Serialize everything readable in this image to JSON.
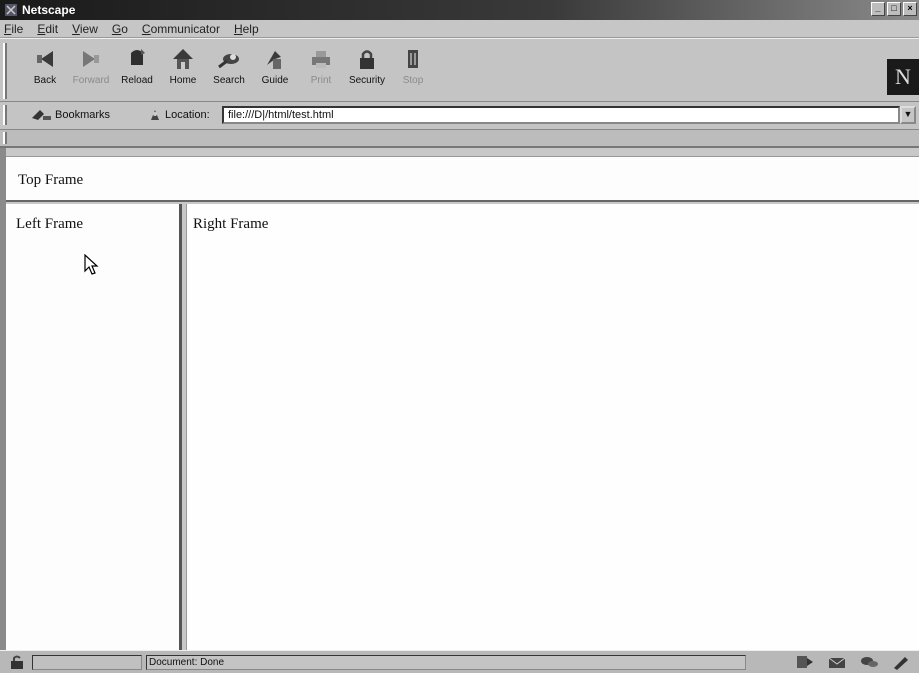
{
  "window": {
    "title": "Netscape",
    "controls": [
      "_",
      "□",
      "×"
    ]
  },
  "menubar": {
    "items": [
      {
        "underline": "F",
        "rest": "ile"
      },
      {
        "underline": "E",
        "rest": "dit"
      },
      {
        "underline": "V",
        "rest": "iew"
      },
      {
        "underline": "G",
        "rest": "o"
      },
      {
        "underline": "C",
        "rest": "ommunicator"
      },
      {
        "underline": "H",
        "rest": "elp"
      }
    ]
  },
  "toolbar": {
    "buttons": [
      {
        "label": "Back",
        "icon": "back-arrow-icon",
        "enabled": true
      },
      {
        "label": "Forward",
        "icon": "forward-arrow-icon",
        "enabled": false
      },
      {
        "label": "Reload",
        "icon": "reload-icon",
        "enabled": true
      },
      {
        "label": "Home",
        "icon": "home-icon",
        "enabled": true
      },
      {
        "label": "Search",
        "icon": "search-icon",
        "enabled": true
      },
      {
        "label": "Guide",
        "icon": "guide-icon",
        "enabled": true
      },
      {
        "label": "Print",
        "icon": "print-icon",
        "enabled": false
      },
      {
        "label": "Security",
        "icon": "lock-icon",
        "enabled": true
      },
      {
        "label": "Stop",
        "icon": "stop-icon",
        "enabled": false
      }
    ],
    "logo": "N"
  },
  "locationbar": {
    "bookmarks_label": "Bookmarks",
    "location_label": "Location:",
    "url": "file:///D|/html/test.html"
  },
  "frames": {
    "top": "Top Frame",
    "left": "Left Frame",
    "right": "Right Frame"
  },
  "statusbar": {
    "text": "Document: Done"
  }
}
